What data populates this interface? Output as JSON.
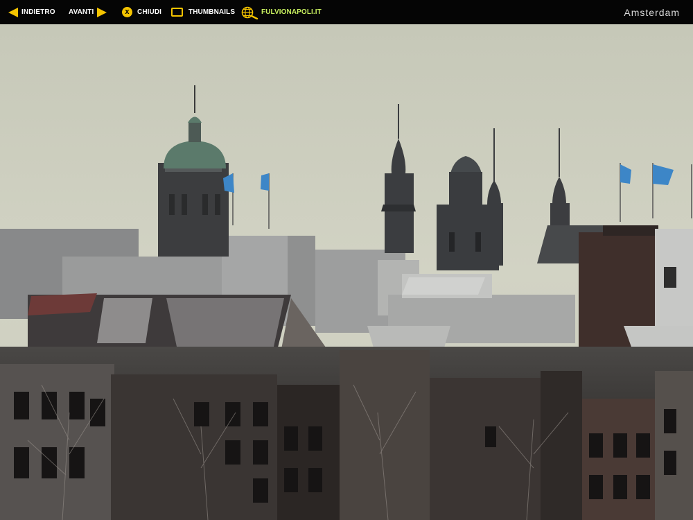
{
  "toolbar": {
    "back_label": "INDIETRO",
    "forward_label": "AVANTI",
    "close_label": "CHIUDI",
    "thumbnails_label": "THUMBNAILS",
    "site_label": "FULVIONAPOLI.IT"
  },
  "gallery": {
    "title": "Amsterdam"
  },
  "icons": {
    "back": "arrow-left-icon",
    "forward": "arrow-right-icon",
    "close": "close-circle-icon",
    "thumbnails": "thumbnails-icon",
    "site": "globe-magnifier-icon"
  },
  "colors": {
    "toolbar_bg": "#050505",
    "accent": "#f5c400",
    "site_link": "#c8f060",
    "sky": "#cfd0c0"
  }
}
